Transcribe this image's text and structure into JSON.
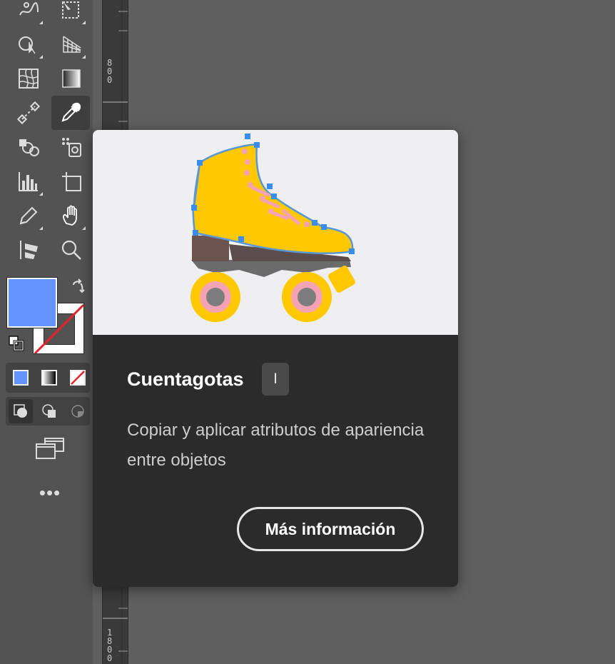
{
  "ruler": {
    "mark_top": "800",
    "mark_bottom": "1800"
  },
  "toolbar": {
    "tools": [
      {
        "name": "puppet-warp-icon"
      },
      {
        "name": "free-transform-icon"
      },
      {
        "name": "shape-builder-icon"
      },
      {
        "name": "perspective-grid-icon"
      },
      {
        "name": "mesh-icon"
      },
      {
        "name": "gradient-icon"
      },
      {
        "name": "blend-icon"
      },
      {
        "name": "eyedropper-icon"
      },
      {
        "name": "symbol-sprayer-icon"
      },
      {
        "name": "live-paint-icon"
      },
      {
        "name": "column-graph-icon"
      },
      {
        "name": "artboard-icon"
      },
      {
        "name": "pencil-icon"
      },
      {
        "name": "hand-icon"
      },
      {
        "name": "puppet-flag-icon"
      },
      {
        "name": "zoom-icon"
      }
    ],
    "fill_color": "#6495ff",
    "stroke_color": "none",
    "more_label": "•••"
  },
  "tooltip": {
    "title": "Cuentagotas",
    "shortcut": "I",
    "description": "Copiar y aplicar atributos de apariencia entre objetos",
    "learn_more": "Más información",
    "illustration": "roller-skate-illustration"
  },
  "colors": {
    "card_bg": "#2b2b2b",
    "illustration_bg": "#efeff1",
    "skate_yellow": "#ffc800",
    "anchor_blue": "#3b8ded"
  }
}
